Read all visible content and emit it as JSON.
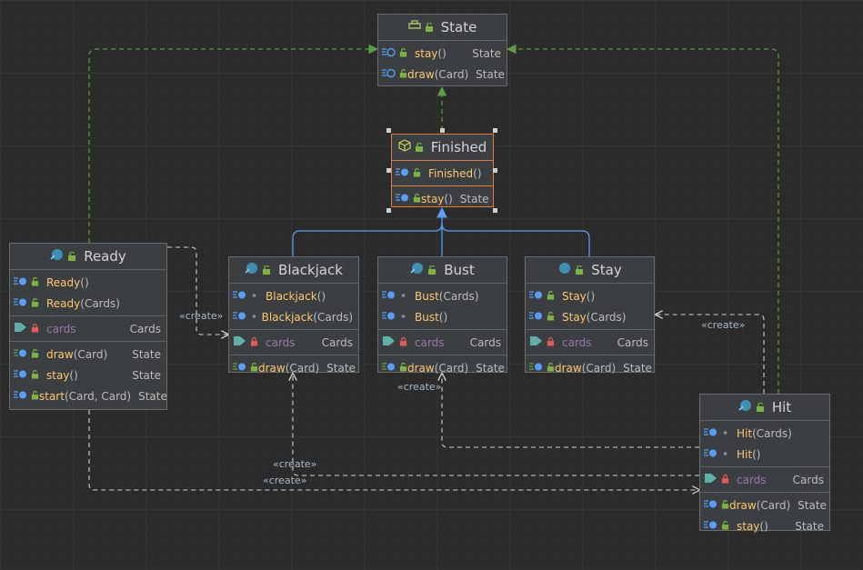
{
  "diagram": {
    "create_label": "«create»",
    "classes": {
      "state": {
        "name": "State",
        "methods": [
          {
            "name": "stay",
            "params": "()",
            "type": "State"
          },
          {
            "name": "draw",
            "params": "(Card)",
            "type": "State"
          }
        ]
      },
      "finished": {
        "name": "Finished",
        "constructors": [
          {
            "name": "Finished",
            "params": "()"
          }
        ],
        "methods": [
          {
            "name": "stay",
            "params": "()",
            "type": "State"
          }
        ]
      },
      "ready": {
        "name": "Ready",
        "constructors": [
          {
            "name": "Ready",
            "params": "()"
          },
          {
            "name": "Ready",
            "params": "(Cards)"
          }
        ],
        "fields": [
          {
            "name": "cards",
            "type": "Cards"
          }
        ],
        "methods": [
          {
            "name": "draw",
            "params": "(Card)",
            "type": "State"
          },
          {
            "name": "stay",
            "params": "()",
            "type": "State"
          },
          {
            "name": "start",
            "params": "(Card, Card)",
            "type": "State"
          }
        ]
      },
      "blackjack": {
        "name": "Blackjack",
        "constructors": [
          {
            "name": "Blackjack",
            "params": "()"
          },
          {
            "name": "Blackjack",
            "params": "(Cards)"
          }
        ],
        "fields": [
          {
            "name": "cards",
            "type": "Cards"
          }
        ],
        "methods": [
          {
            "name": "draw",
            "params": "(Card)",
            "type": "State"
          }
        ]
      },
      "bust": {
        "name": "Bust",
        "constructors": [
          {
            "name": "Bust",
            "params": "(Cards)"
          },
          {
            "name": "Bust",
            "params": "()"
          }
        ],
        "fields": [
          {
            "name": "cards",
            "type": "Cards"
          }
        ],
        "methods": [
          {
            "name": "draw",
            "params": "(Card)",
            "type": "State"
          }
        ]
      },
      "stay": {
        "name": "Stay",
        "constructors": [
          {
            "name": "Stay",
            "params": "()"
          },
          {
            "name": "Stay",
            "params": "(Cards)"
          }
        ],
        "fields": [
          {
            "name": "cards",
            "type": "Cards"
          }
        ],
        "methods": [
          {
            "name": "draw",
            "params": "(Card)",
            "type": "State"
          }
        ]
      },
      "hit": {
        "name": "Hit",
        "constructors": [
          {
            "name": "Hit",
            "params": "(Cards)"
          },
          {
            "name": "Hit",
            "params": "()"
          }
        ],
        "fields": [
          {
            "name": "cards",
            "type": "Cards"
          }
        ],
        "methods": [
          {
            "name": "draw",
            "params": "(Card)",
            "type": "State"
          },
          {
            "name": "stay",
            "params": "()",
            "type": "State"
          }
        ]
      }
    }
  },
  "colors": {
    "background": "#2b2b2b",
    "node_fill": "#3c3f41",
    "method_name": "#ffc66d",
    "field_name": "#9876aa",
    "inherit_arrow": "#589df6",
    "implement_arrow": "#5c9e43",
    "dependency_arrow": "#cfcfcf",
    "selection": "#e07b39"
  }
}
